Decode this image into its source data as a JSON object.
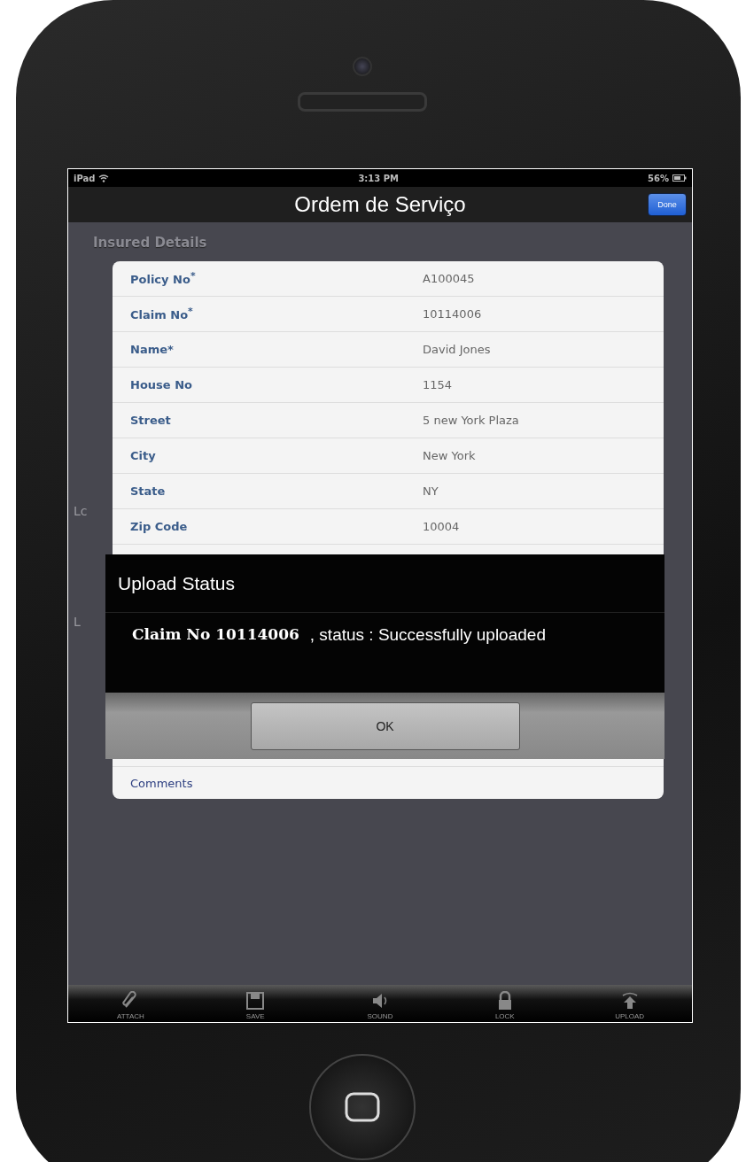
{
  "status_bar": {
    "device": "iPad",
    "time": "3:13 PM",
    "battery": "56%"
  },
  "nav_bar": {
    "title": "Ordem de Serviço",
    "done_button": "Done"
  },
  "section_title": "Insured Details",
  "side_labels": [
    "Lc",
    "L"
  ],
  "fields": [
    {
      "label": "Policy No$^{*}$",
      "value": "A100045"
    },
    {
      "label": "Claim No$^{*}$",
      "value": "10114006"
    },
    {
      "label": "Name*",
      "value": "David Jones"
    },
    {
      "label": "House No",
      "value": "1154"
    },
    {
      "label": "Street",
      "value": "5 new York Plaza"
    },
    {
      "label": "City",
      "value": "New York"
    },
    {
      "label": "State",
      "value": "NY"
    },
    {
      "label": "Zip Code",
      "value": "10004"
    }
  ],
  "last_field": {
    "label": "Comments"
  },
  "dialog": {
    "title": "Upload Status",
    "message_claim": "Claim No 10114006",
    "message_status": ", status : Successfully uploaded",
    "button": "OK"
  },
  "toolbar": [
    {
      "kind": "attach",
      "label": "ATTACH"
    },
    {
      "kind": "save",
      "label": "SAVE"
    },
    {
      "kind": "sound",
      "label": "SOUND"
    },
    {
      "kind": "lock",
      "label": "LOCK"
    },
    {
      "kind": "upload",
      "label": "UPLOAD"
    }
  ]
}
